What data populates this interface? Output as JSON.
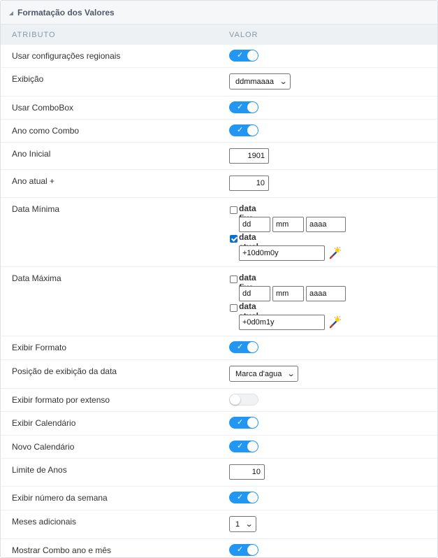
{
  "panel": {
    "title": "Formatação dos Valores"
  },
  "columns": {
    "attribute": "ATRIBUTO",
    "value": "VALOR"
  },
  "rows": {
    "regional": {
      "label": "Usar configurações regionais",
      "on": true
    },
    "exibicao": {
      "label": "Exibição",
      "selected": "ddmmaaaa"
    },
    "combobox": {
      "label": "Usar ComboBox",
      "on": true
    },
    "ano_combo": {
      "label": "Ano como Combo",
      "on": true
    },
    "ano_inicial": {
      "label": "Ano Inicial",
      "value": "1901"
    },
    "ano_atual": {
      "label": "Ano atual +",
      "value": "10"
    },
    "data_minima": {
      "label": "Data Mínima",
      "fixa_label": "data fixa",
      "fixa_checked": false,
      "dd": "dd",
      "mm": "mm",
      "aaaa": "aaaa",
      "atual_label": "data atual",
      "atual_checked": true,
      "atual_value": "+10d0m0y"
    },
    "data_maxima": {
      "label": "Data Máxima",
      "fixa_label": "data fixa",
      "fixa_checked": false,
      "dd": "dd",
      "mm": "mm",
      "aaaa": "aaaa",
      "atual_label": "data atual",
      "atual_checked": false,
      "atual_value": "+0d0m1y"
    },
    "exibir_formato": {
      "label": "Exibir Formato",
      "on": true
    },
    "posicao": {
      "label": "Posição de exibição da data",
      "selected": "Marca d'agua"
    },
    "formato_extenso": {
      "label": "Exibir formato por extenso",
      "on": false
    },
    "exibir_calendario": {
      "label": "Exibir Calendário",
      "on": true
    },
    "novo_calendario": {
      "label": "Novo Calendário",
      "on": true
    },
    "limite_anos": {
      "label": "Limite de Anos",
      "value": "10"
    },
    "numero_semana": {
      "label": "Exibir número da semana",
      "on": true
    },
    "meses_adicionais": {
      "label": "Meses adicionais",
      "selected": "1"
    },
    "combo_ano_mes": {
      "label": "Mostrar Combo ano e mês",
      "on": true
    }
  },
  "icons": {
    "collapse": "triangle-collapse-icon",
    "wand": "magic-wand-icon",
    "check": "check-icon",
    "dropdown": "chevron-down-icon"
  },
  "colors": {
    "toggle_on": "#2196f3",
    "checkbox_on": "#0b6fd4",
    "header_bg": "#f6f7f9"
  }
}
